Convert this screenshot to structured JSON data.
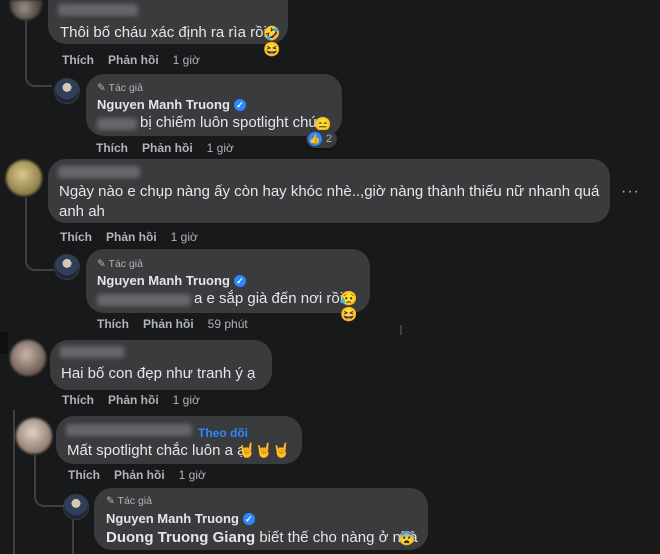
{
  "actions": {
    "like": "Thích",
    "reply": "Phản hồi"
  },
  "author_badge": "Tác giả",
  "author_name": "Nguyen Manh Truong",
  "comments": [
    {
      "text": "Thôi bố cháu xác định ra rìa rồi",
      "emoji": "🤣 😆",
      "time": "1 giờ"
    },
    {
      "text": "bị chiếm luôn spotlight chứ",
      "emoji": "😑",
      "time": "1 giờ",
      "reaction_count": "2"
    },
    {
      "line1": "Ngày nào e chụp nàng ấy còn hay khóc nhè..,giờ nàng thành thiếu nữ nhanh quá",
      "line2": "anh ah",
      "time": "1 giờ",
      "more": "···"
    },
    {
      "text": "a e sắp già đến nơi rồi",
      "emoji": "😥 😆",
      "time": "59 phút"
    },
    {
      "text": "Hai bố con đẹp như tranh ý ạ",
      "time": "1 giờ"
    },
    {
      "follow": "Theo dõi",
      "text": "Mất spotlight chắc luôn a ạ",
      "emoji": "🤘🤘🤘",
      "time": "1 giờ"
    },
    {
      "mention": "Duong Truong Giang",
      "text": " biết thế cho nàng ở nhà",
      "emoji": "😨"
    }
  ]
}
